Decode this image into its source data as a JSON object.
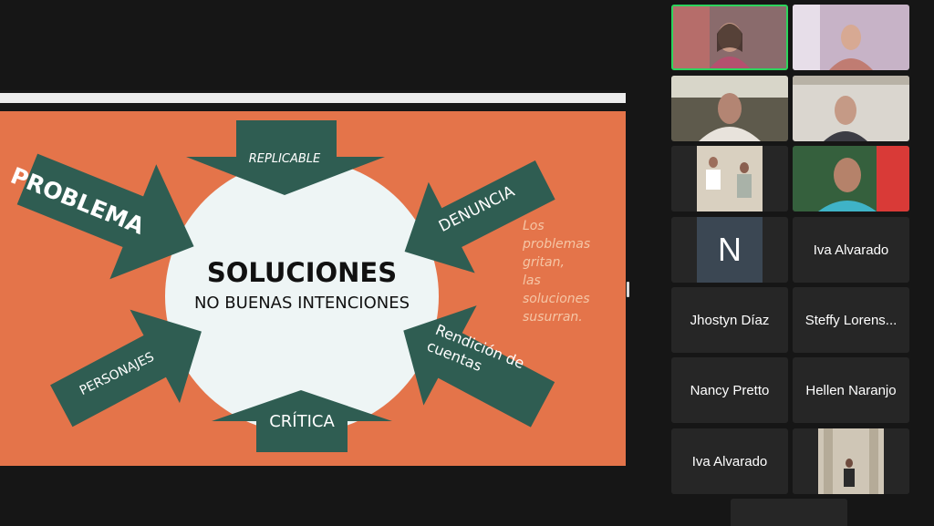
{
  "slide": {
    "title": "SOLUCIONES",
    "subtitle": "NO BUENAS INTENCIONES",
    "arrows": {
      "problema": "PROBLEMA",
      "replicable": "REPLICABLE",
      "denuncia": "DENUNCIA",
      "rendicion_line1": "Rendición de",
      "rendicion_line2": "cuentas",
      "critica": "CRÍTICA",
      "personajes": "PERSONAJES"
    },
    "quote": "Los\nproblemas\ngritan,\nlas\nsoluciones\nsusurran.",
    "colors": {
      "background": "#e4744a",
      "arrow": "#2f5d52",
      "circle": "#eef5f5",
      "quote": "#f5c6a6"
    }
  },
  "participants": [
    {
      "name": "",
      "type": "video",
      "active": true
    },
    {
      "name": "",
      "type": "video"
    },
    {
      "name": "",
      "type": "video"
    },
    {
      "name": "",
      "type": "video"
    },
    {
      "name": "",
      "type": "video"
    },
    {
      "name": "",
      "type": "video"
    },
    {
      "name": "",
      "type": "initial",
      "initial": "N"
    },
    {
      "name": "Iva Alvarado",
      "type": "name"
    },
    {
      "name": "Jhostyn Díaz",
      "type": "name"
    },
    {
      "name": "Steffy Lorens...",
      "type": "name"
    },
    {
      "name": "Nancy Pretto",
      "type": "name"
    },
    {
      "name": "Hellen Naranjo",
      "type": "name"
    },
    {
      "name": "Iva Alvarado",
      "type": "name"
    },
    {
      "name": "",
      "type": "video"
    }
  ],
  "colors": {
    "active_speaker_border": "#2dd45d",
    "tile_bg": "#262626"
  }
}
